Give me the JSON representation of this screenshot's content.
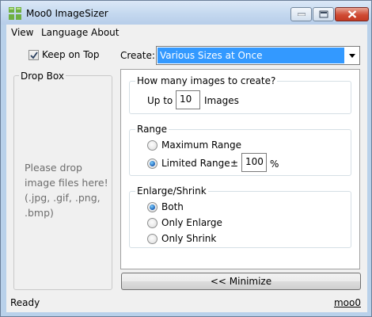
{
  "window": {
    "title": "Moo0 ImageSizer",
    "icons": {
      "app": "app-grid-icon",
      "minimize": "minimize-icon",
      "maximize": "maximize-icon",
      "close": "close-icon"
    }
  },
  "menu": {
    "items": [
      "View",
      "Language",
      "About"
    ]
  },
  "keep_on_top": {
    "label": "Keep on Top",
    "checked": true
  },
  "drop_box": {
    "title": "Drop Box",
    "hint": "Please drop image files here! (.jpg, .gif, .png, .bmp)"
  },
  "create": {
    "label": "Create:",
    "selected": "Various Sizes at Once"
  },
  "how_many": {
    "title": "How many images to create?",
    "prefix": "Up to",
    "value": "10",
    "suffix": "Images"
  },
  "range": {
    "title": "Range",
    "options": [
      {
        "label": "Maximum Range",
        "selected": false
      },
      {
        "label": "Limited Range",
        "selected": true
      }
    ],
    "plusminus": "±",
    "value": "100",
    "unit": "%"
  },
  "enlarge_shrink": {
    "title": "Enlarge/Shrink",
    "options": [
      {
        "label": "Both",
        "selected": true
      },
      {
        "label": "Only Enlarge",
        "selected": false
      },
      {
        "label": "Only Shrink",
        "selected": false
      }
    ]
  },
  "minimize_button": {
    "label": "<< Minimize"
  },
  "status": {
    "text": "Ready",
    "link": "moo0"
  },
  "colors": {
    "selection": "#3399ff",
    "title_gradient_top": "#dbe8f7",
    "close_red": "#cf4b34"
  }
}
